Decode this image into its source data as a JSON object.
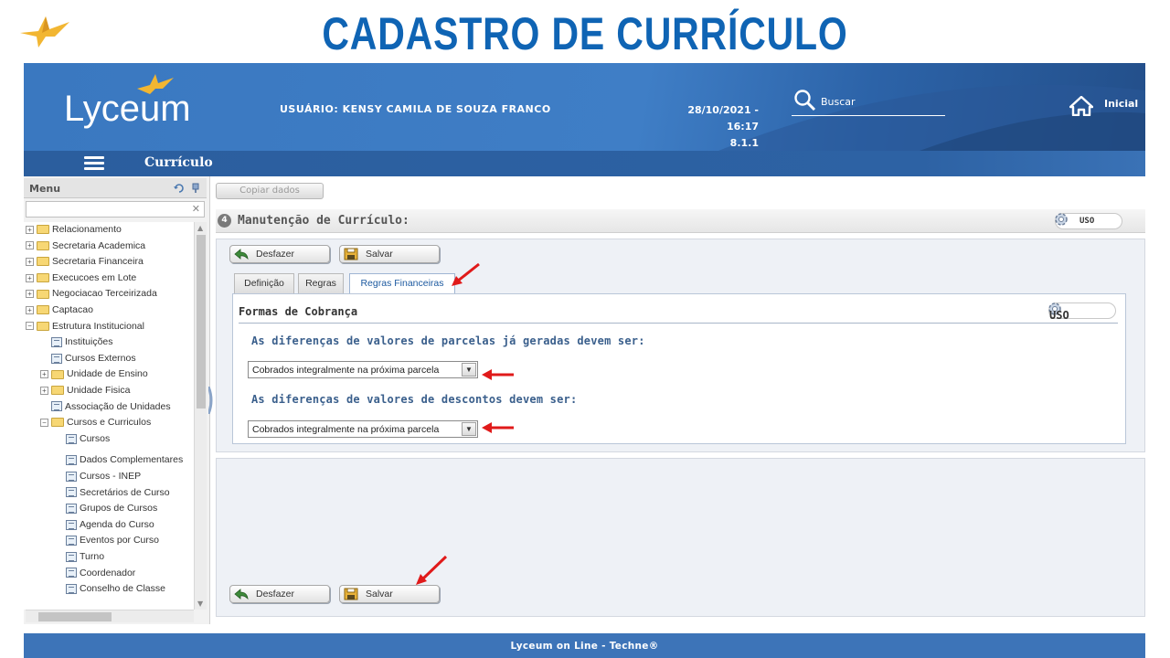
{
  "slide": {
    "title": "CADASTRO DE CURRÍCULO"
  },
  "header": {
    "logo": "Lyceum",
    "user_label": "USUÁRIO:",
    "user_name": "KENSY CAMILA DE SOUZA FRANCO",
    "datetime": "28/10/2021 - 16:17",
    "version": "8.1.1",
    "search_label": "Buscar",
    "home_label": "Inicial"
  },
  "subbar": {
    "title": "Currículo"
  },
  "sidebar": {
    "menu_label": "Menu",
    "filter_value": "",
    "items": [
      {
        "label": "Relacionamento",
        "type": "folder",
        "level": 0,
        "expanded": false
      },
      {
        "label": "Secretaria Academica",
        "type": "folder",
        "level": 0,
        "expanded": false
      },
      {
        "label": "Secretaria Financeira",
        "type": "folder",
        "level": 0,
        "expanded": false
      },
      {
        "label": "Execucoes em Lote",
        "type": "folder",
        "level": 0,
        "expanded": false
      },
      {
        "label": "Negociacao Terceirizada",
        "type": "folder",
        "level": 0,
        "expanded": false
      },
      {
        "label": "Captacao",
        "type": "folder",
        "level": 0,
        "expanded": false
      },
      {
        "label": "Estrutura Institucional",
        "type": "folder",
        "level": 0,
        "expanded": true
      },
      {
        "label": "Instituições",
        "type": "doc",
        "level": 1
      },
      {
        "label": "Cursos Externos",
        "type": "doc",
        "level": 1
      },
      {
        "label": "Unidade de Ensino",
        "type": "folder",
        "level": 1,
        "expanded": false
      },
      {
        "label": "Unidade Fisica",
        "type": "folder",
        "level": 1,
        "expanded": false
      },
      {
        "label": "Associação de Unidades",
        "type": "doc",
        "level": 1
      },
      {
        "label": "Cursos e Curriculos",
        "type": "folder",
        "level": 1,
        "expanded": true
      },
      {
        "label": "Cursos",
        "type": "doc",
        "level": 2
      },
      {
        "label": "Dados Complementares",
        "type": "doc",
        "level": 2
      },
      {
        "label": "Cursos - INEP",
        "type": "doc",
        "level": 2
      },
      {
        "label": "Secretários de Curso",
        "type": "doc",
        "level": 2
      },
      {
        "label": "Grupos de Cursos",
        "type": "doc",
        "level": 2
      },
      {
        "label": "Agenda do Curso",
        "type": "doc",
        "level": 2
      },
      {
        "label": "Eventos por Curso",
        "type": "doc",
        "level": 2
      },
      {
        "label": "Turno",
        "type": "doc",
        "level": 2
      },
      {
        "label": "Coordenador",
        "type": "doc",
        "level": 2
      },
      {
        "label": "Conselho de Classe",
        "type": "doc",
        "level": 2
      }
    ]
  },
  "main": {
    "copy_button": "Copiar dados",
    "section_number": "4",
    "section_title": "Manutenção de Currículo:",
    "uso_label": "USO",
    "undo_label": "Desfazer",
    "save_label": "Salvar",
    "tabs": [
      {
        "label": "Definição"
      },
      {
        "label": "Regras"
      },
      {
        "label": "Regras Financeiras"
      }
    ],
    "active_tab": "Regras Financeiras",
    "panel_title": "Formas de Cobrança",
    "question1": "As diferenças de valores de parcelas já geradas devem ser:",
    "select1_value": "Cobrados integralmente na próxima parcela",
    "question2": "As diferenças de valores de descontos devem ser:",
    "select2_value": "Cobrados integralmente na próxima parcela"
  },
  "footer": {
    "text": "Lyceum on Line - Techne®"
  },
  "colors": {
    "title_blue": "#0f64b4",
    "header_blue": "#3f7ec6",
    "annotation_red": "#e01a1a"
  }
}
